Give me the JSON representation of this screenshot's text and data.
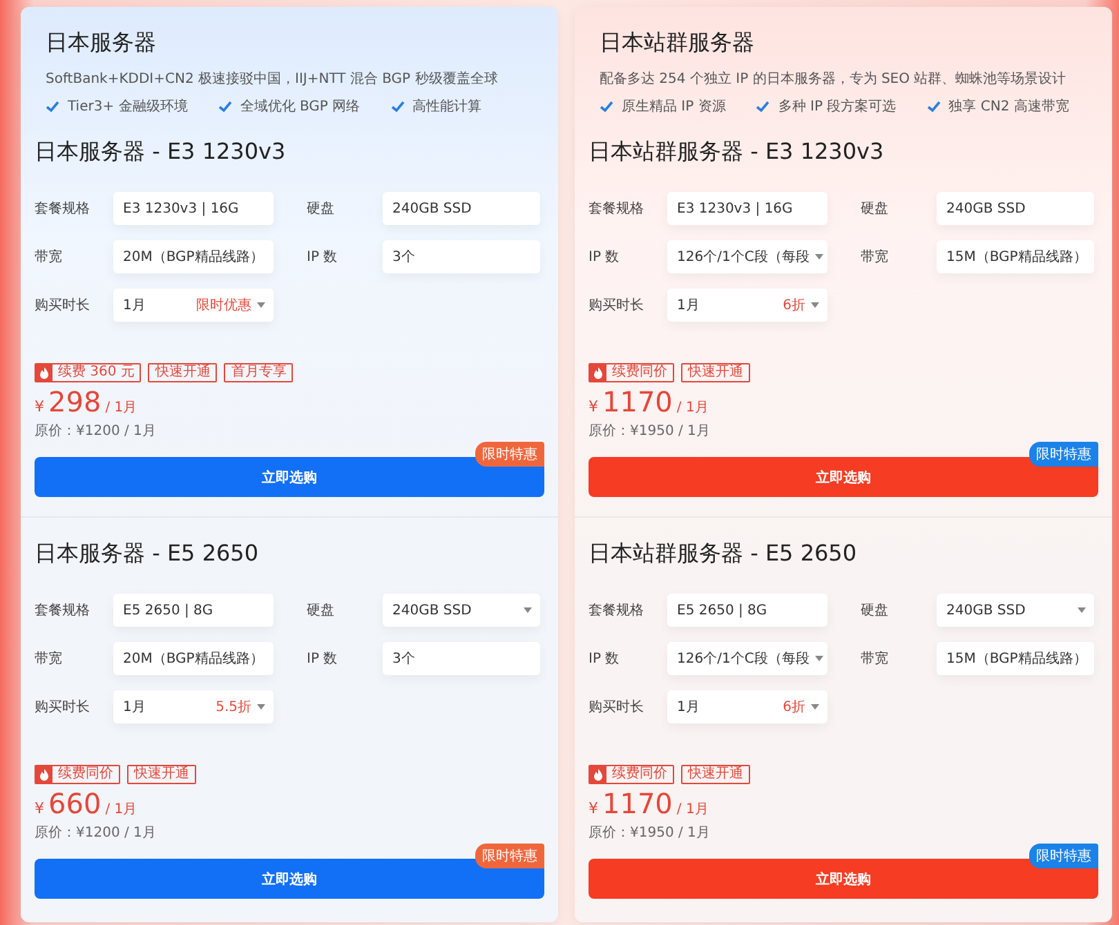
{
  "columns": [
    {
      "color": "#1170f5",
      "title": "日本服务器",
      "subtitle": "SoftBank+KDDI+CN2 极速接驳中国，IIJ+NTT 混合 BGP 秒级覆盖全球",
      "features": [
        "Tier3+ 金融级环境",
        "全域优化 BGP 网络",
        "高性能计算"
      ],
      "products": [
        {
          "title": "日本服务器 - E3 1230v3",
          "fields": [
            {
              "label": "套餐规格",
              "value": "E3 1230v3 | 16G",
              "kind": "text"
            },
            {
              "label": "硬盘",
              "value": "240GB SSD",
              "kind": "text"
            },
            {
              "label": "带宽",
              "value": "20M（BGP精品线路）",
              "kind": "text"
            },
            {
              "label": "IP 数",
              "value": "3个",
              "kind": "text"
            },
            {
              "label": "购买时长",
              "value": "1月",
              "kind": "select",
              "note": "限时优惠"
            }
          ],
          "tags": [
            {
              "text": "续费 360 元",
              "hot": true
            },
            {
              "text": "快速开通",
              "hot": false
            },
            {
              "text": "首月专享",
              "hot": false
            }
          ],
          "currency": "¥",
          "price": "298",
          "unit": "/ 1月",
          "original": "原价：¥1200 / 1月",
          "ribbon": {
            "text": "限时特惠",
            "color": "#f0663c"
          },
          "button": "立即选购"
        },
        {
          "title": "日本服务器 - E5 2650",
          "fields": [
            {
              "label": "套餐规格",
              "value": "E5 2650 | 8G",
              "kind": "text"
            },
            {
              "label": "硬盘",
              "value": "240GB SSD",
              "kind": "select"
            },
            {
              "label": "带宽",
              "value": "20M（BGP精品线路）",
              "kind": "text"
            },
            {
              "label": "IP 数",
              "value": "3个",
              "kind": "text"
            },
            {
              "label": "购买时长",
              "value": "1月",
              "kind": "select",
              "note": "5.5折"
            }
          ],
          "tags": [
            {
              "text": "续费同价",
              "hot": true
            },
            {
              "text": "快速开通",
              "hot": false
            }
          ],
          "currency": "¥",
          "price": "660",
          "unit": "/ 1月",
          "original": "原价：¥1200 / 1月",
          "ribbon": {
            "text": "限时特惠",
            "color": "#f0663c"
          },
          "button": "立即选购"
        }
      ]
    },
    {
      "color": "#f63c22",
      "title": "日本站群服务器",
      "subtitle": "配备多达 254 个独立 IP 的日本服务器，专为 SEO 站群、蜘蛛池等场景设计",
      "features": [
        "原生精品 IP 资源",
        "多种 IP 段方案可选",
        "独享 CN2 高速带宽"
      ],
      "products": [
        {
          "title": "日本站群服务器 - E3 1230v3",
          "fields": [
            {
              "label": "套餐规格",
              "value": "E3 1230v3 | 16G",
              "kind": "text"
            },
            {
              "label": "硬盘",
              "value": "240GB SSD",
              "kind": "text"
            },
            {
              "label": "IP 数",
              "value": "126个/1个C段（每段",
              "kind": "select"
            },
            {
              "label": "带宽",
              "value": "15M（BGP精品线路）",
              "kind": "text"
            },
            {
              "label": "购买时长",
              "value": "1月",
              "kind": "select",
              "note": "6折"
            }
          ],
          "tags": [
            {
              "text": "续费同价",
              "hot": true
            },
            {
              "text": "快速开通",
              "hot": false
            }
          ],
          "currency": "¥",
          "price": "1170",
          "unit": "/ 1月",
          "original": "原价：¥1950 / 1月",
          "ribbon": {
            "text": "限时特惠",
            "color": "#1a82e8"
          },
          "button": "立即选购"
        },
        {
          "title": "日本站群服务器 - E5 2650",
          "fields": [
            {
              "label": "套餐规格",
              "value": "E5 2650 | 8G",
              "kind": "text"
            },
            {
              "label": "硬盘",
              "value": "240GB SSD",
              "kind": "select"
            },
            {
              "label": "IP 数",
              "value": "126个/1个C段（每段",
              "kind": "select"
            },
            {
              "label": "带宽",
              "value": "15M（BGP精品线路）",
              "kind": "text"
            },
            {
              "label": "购买时长",
              "value": "1月",
              "kind": "select",
              "note": "6折"
            }
          ],
          "tags": [
            {
              "text": "续费同价",
              "hot": true
            },
            {
              "text": "快速开通",
              "hot": false
            }
          ],
          "currency": "¥",
          "price": "1170",
          "unit": "/ 1月",
          "original": "原价：¥1950 / 1月",
          "ribbon": {
            "text": "限时特惠",
            "color": "#1a82e8"
          },
          "button": "立即选购"
        }
      ]
    }
  ]
}
